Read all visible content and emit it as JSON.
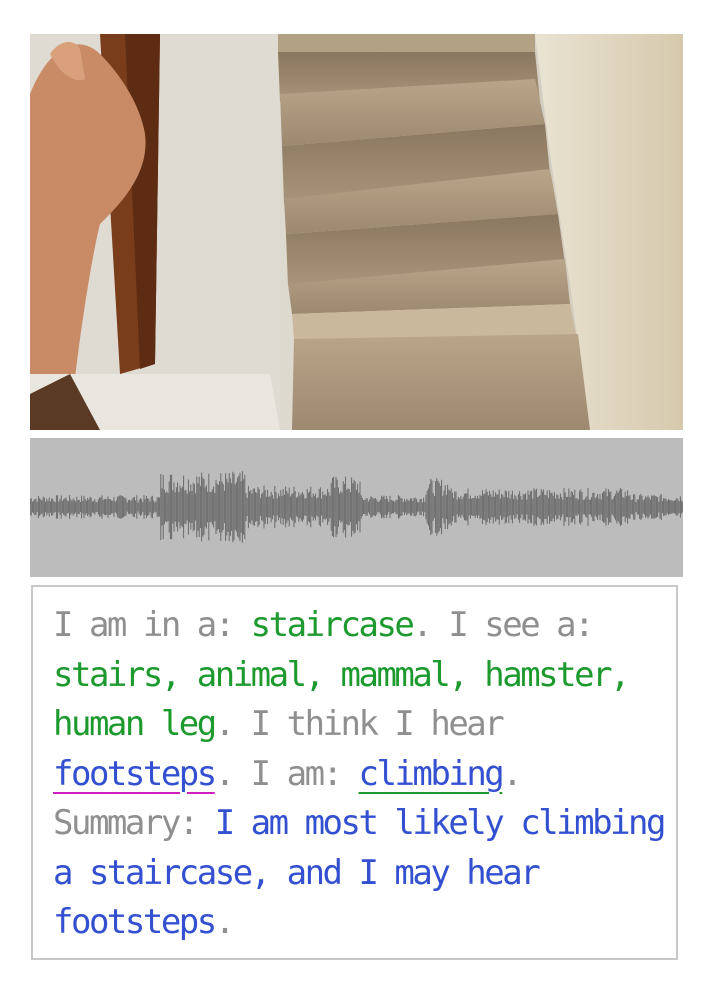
{
  "colors": {
    "prefix_gray": "#8f8f8f",
    "detected_green": "#1c9a2e",
    "inferred_blue": "#3350d0",
    "sound_underline": "#d01fbf",
    "action_underline": "#1c9a2e",
    "waveform_bg": "#bcbcbc"
  },
  "caption": {
    "place_prefix": "I am in a: ",
    "place": "staircase",
    "see_prefix": ". I see a: ",
    "objects": "stairs, animal, mammal, hamster, human leg",
    "hear_prefix": ". I think I hear ",
    "sound": "footsteps",
    "action_prefix": ". I am: ",
    "action": "climbing",
    "summary_prefix": ". Summary: ",
    "summary": "I am most likely climbing a staircase, and I may hear footsteps",
    "end": "."
  }
}
